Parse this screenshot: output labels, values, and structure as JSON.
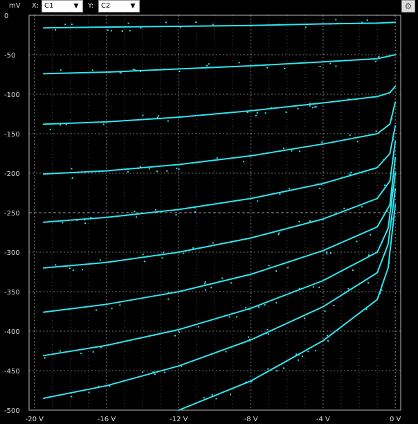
{
  "toolbar": {
    "unit_label": "mV",
    "x_label": "X:",
    "x_selected": "C1",
    "y_label": "Y:",
    "y_selected": "C2",
    "settings_icon": "gear-icon"
  },
  "colors": {
    "trace": "#2ee6f0",
    "grid": "#ffffff",
    "background": "#000000"
  },
  "chart_data": {
    "type": "line",
    "xlim": [
      -20.3,
      0.3
    ],
    "ylim": [
      -500,
      0
    ],
    "x_ticks": [
      {
        "value": -20,
        "label": "-20 V"
      },
      {
        "value": -16,
        "label": "-16 V"
      },
      {
        "value": -12,
        "label": "-12 V"
      },
      {
        "value": -8,
        "label": "-8 V"
      },
      {
        "value": -4,
        "label": "-4 V"
      },
      {
        "value": 0,
        "label": "0 V"
      }
    ],
    "y_ticks": [
      {
        "value": 0,
        "label": "0"
      },
      {
        "value": -50,
        "label": "-50"
      },
      {
        "value": -100,
        "label": "-100"
      },
      {
        "value": -150,
        "label": "-150"
      },
      {
        "value": -200,
        "label": "-200"
      },
      {
        "value": -250,
        "label": "-250"
      },
      {
        "value": -300,
        "label": "-300"
      },
      {
        "value": -350,
        "label": "-350"
      },
      {
        "value": -400,
        "label": "-400"
      },
      {
        "value": -450,
        "label": "-450"
      },
      {
        "value": -500,
        "label": "-500"
      }
    ],
    "grid": true,
    "series": [
      {
        "x": [
          -19.5,
          -16,
          -12,
          -8,
          -4,
          -1,
          0
        ],
        "y": [
          -16,
          -15,
          -14,
          -13,
          -11,
          -10,
          -9
        ]
      },
      {
        "x": [
          -19.5,
          -16,
          -12,
          -8,
          -4,
          -1,
          0
        ],
        "y": [
          -74,
          -72,
          -68,
          -64,
          -59,
          -55,
          -50
        ]
      },
      {
        "x": [
          -19.5,
          -16,
          -12,
          -8,
          -4,
          -1,
          -0.3,
          0
        ],
        "y": [
          -138,
          -135,
          -129,
          -121,
          -111,
          -103,
          -98,
          -90
        ]
      },
      {
        "x": [
          -19.5,
          -16,
          -12,
          -8,
          -4,
          -1,
          -0.3,
          0
        ],
        "y": [
          -201,
          -197,
          -189,
          -178,
          -163,
          -150,
          -138,
          -110
        ]
      },
      {
        "x": [
          -19.5,
          -16,
          -12,
          -8,
          -4,
          -1,
          -0.3,
          0
        ],
        "y": [
          -262,
          -256,
          -246,
          -232,
          -213,
          -193,
          -175,
          -140
        ]
      },
      {
        "x": [
          -19.5,
          -16,
          -12,
          -8,
          -4,
          -1,
          -0.3,
          0
        ],
        "y": [
          -320,
          -313,
          -300,
          -282,
          -258,
          -232,
          -210,
          -160
        ]
      },
      {
        "x": [
          -19.5,
          -16,
          -12,
          -8,
          -4,
          -1,
          -0.3,
          0
        ],
        "y": [
          -376,
          -366,
          -350,
          -328,
          -298,
          -268,
          -240,
          -180
        ]
      },
      {
        "x": [
          -19.5,
          -16,
          -12,
          -8,
          -4,
          -1,
          -0.4,
          0
        ],
        "y": [
          -431,
          -418,
          -398,
          -371,
          -336,
          -300,
          -270,
          -200
        ]
      },
      {
        "x": [
          -19.5,
          -16,
          -12,
          -8,
          -4,
          -1,
          -0.4,
          0
        ],
        "y": [
          -485,
          -469,
          -444,
          -411,
          -369,
          -326,
          -290,
          -220
        ]
      },
      {
        "x": [
          -12,
          -8,
          -4,
          -1,
          -0.4,
          0
        ],
        "y": [
          -500,
          -463,
          -412,
          -360,
          -320,
          -240
        ]
      }
    ]
  }
}
